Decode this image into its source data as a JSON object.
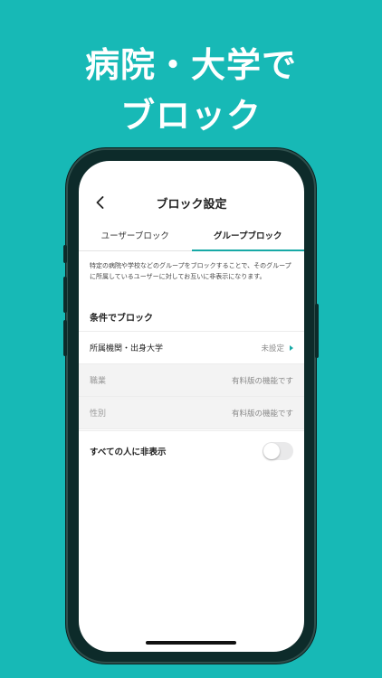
{
  "headline": {
    "line1": "病院・大学で",
    "line2": "ブロック"
  },
  "navbar": {
    "title": "ブロック設定",
    "back_icon": "chevron-left-icon"
  },
  "tabs": [
    {
      "label": "ユーザーブロック",
      "active": false
    },
    {
      "label": "グループブロック",
      "active": true
    }
  ],
  "description": "特定の病院や学校などのグループをブロックすることで、そのグループに所属しているユーザーに対してお互いに非表示になります。",
  "section_title": "条件でブロック",
  "rows": [
    {
      "label": "所属機関・出身大学",
      "value": "未設定",
      "enabled": true
    },
    {
      "label": "職業",
      "value": "有料版の機能です",
      "enabled": false
    },
    {
      "label": "性別",
      "value": "有料版の機能です",
      "enabled": false
    }
  ],
  "toggle": {
    "label": "すべての人に非表示",
    "state": "off"
  },
  "colors": {
    "background": "#17b9b6",
    "accent": "#17a9a6"
  }
}
